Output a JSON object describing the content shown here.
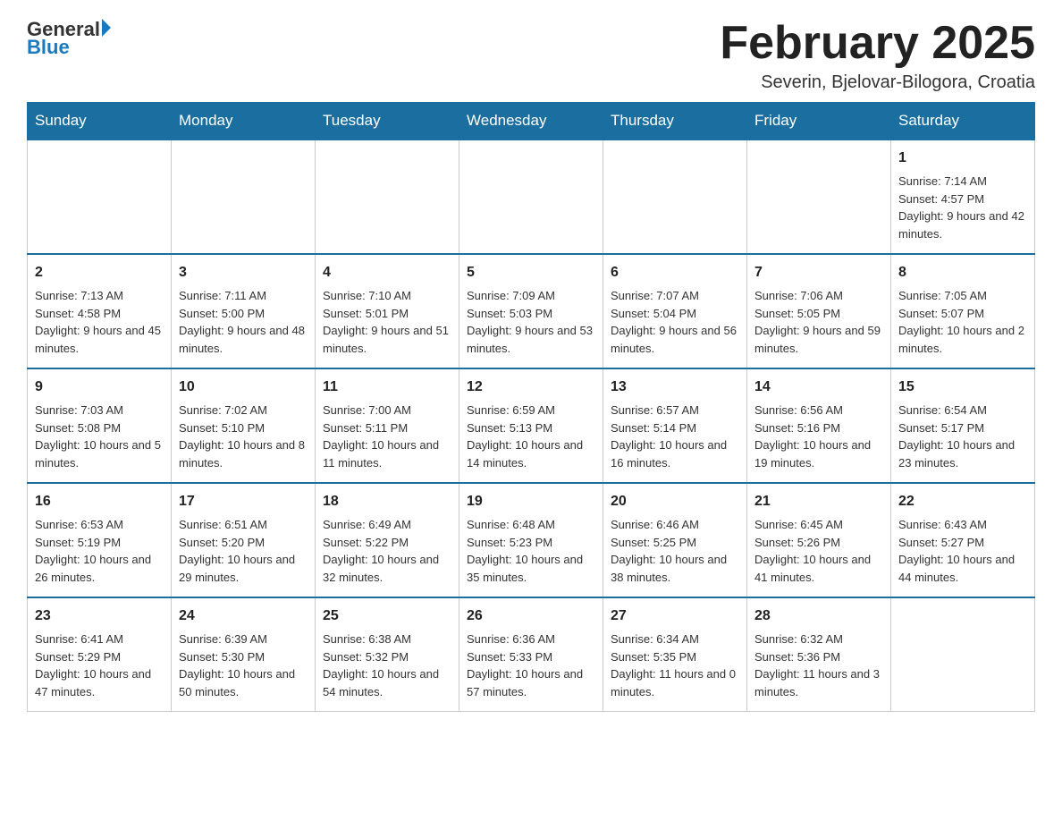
{
  "header": {
    "logo": {
      "general": "General",
      "arrow": "▶",
      "blue": "Blue"
    },
    "title": "February 2025",
    "location": "Severin, Bjelovar-Bilogora, Croatia"
  },
  "calendar": {
    "weekdays": [
      "Sunday",
      "Monday",
      "Tuesday",
      "Wednesday",
      "Thursday",
      "Friday",
      "Saturday"
    ],
    "weeks": [
      [
        {
          "day": "",
          "info": ""
        },
        {
          "day": "",
          "info": ""
        },
        {
          "day": "",
          "info": ""
        },
        {
          "day": "",
          "info": ""
        },
        {
          "day": "",
          "info": ""
        },
        {
          "day": "",
          "info": ""
        },
        {
          "day": "1",
          "info": "Sunrise: 7:14 AM\nSunset: 4:57 PM\nDaylight: 9 hours and 42 minutes."
        }
      ],
      [
        {
          "day": "2",
          "info": "Sunrise: 7:13 AM\nSunset: 4:58 PM\nDaylight: 9 hours and 45 minutes."
        },
        {
          "day": "3",
          "info": "Sunrise: 7:11 AM\nSunset: 5:00 PM\nDaylight: 9 hours and 48 minutes."
        },
        {
          "day": "4",
          "info": "Sunrise: 7:10 AM\nSunset: 5:01 PM\nDaylight: 9 hours and 51 minutes."
        },
        {
          "day": "5",
          "info": "Sunrise: 7:09 AM\nSunset: 5:03 PM\nDaylight: 9 hours and 53 minutes."
        },
        {
          "day": "6",
          "info": "Sunrise: 7:07 AM\nSunset: 5:04 PM\nDaylight: 9 hours and 56 minutes."
        },
        {
          "day": "7",
          "info": "Sunrise: 7:06 AM\nSunset: 5:05 PM\nDaylight: 9 hours and 59 minutes."
        },
        {
          "day": "8",
          "info": "Sunrise: 7:05 AM\nSunset: 5:07 PM\nDaylight: 10 hours and 2 minutes."
        }
      ],
      [
        {
          "day": "9",
          "info": "Sunrise: 7:03 AM\nSunset: 5:08 PM\nDaylight: 10 hours and 5 minutes."
        },
        {
          "day": "10",
          "info": "Sunrise: 7:02 AM\nSunset: 5:10 PM\nDaylight: 10 hours and 8 minutes."
        },
        {
          "day": "11",
          "info": "Sunrise: 7:00 AM\nSunset: 5:11 PM\nDaylight: 10 hours and 11 minutes."
        },
        {
          "day": "12",
          "info": "Sunrise: 6:59 AM\nSunset: 5:13 PM\nDaylight: 10 hours and 14 minutes."
        },
        {
          "day": "13",
          "info": "Sunrise: 6:57 AM\nSunset: 5:14 PM\nDaylight: 10 hours and 16 minutes."
        },
        {
          "day": "14",
          "info": "Sunrise: 6:56 AM\nSunset: 5:16 PM\nDaylight: 10 hours and 19 minutes."
        },
        {
          "day": "15",
          "info": "Sunrise: 6:54 AM\nSunset: 5:17 PM\nDaylight: 10 hours and 23 minutes."
        }
      ],
      [
        {
          "day": "16",
          "info": "Sunrise: 6:53 AM\nSunset: 5:19 PM\nDaylight: 10 hours and 26 minutes."
        },
        {
          "day": "17",
          "info": "Sunrise: 6:51 AM\nSunset: 5:20 PM\nDaylight: 10 hours and 29 minutes."
        },
        {
          "day": "18",
          "info": "Sunrise: 6:49 AM\nSunset: 5:22 PM\nDaylight: 10 hours and 32 minutes."
        },
        {
          "day": "19",
          "info": "Sunrise: 6:48 AM\nSunset: 5:23 PM\nDaylight: 10 hours and 35 minutes."
        },
        {
          "day": "20",
          "info": "Sunrise: 6:46 AM\nSunset: 5:25 PM\nDaylight: 10 hours and 38 minutes."
        },
        {
          "day": "21",
          "info": "Sunrise: 6:45 AM\nSunset: 5:26 PM\nDaylight: 10 hours and 41 minutes."
        },
        {
          "day": "22",
          "info": "Sunrise: 6:43 AM\nSunset: 5:27 PM\nDaylight: 10 hours and 44 minutes."
        }
      ],
      [
        {
          "day": "23",
          "info": "Sunrise: 6:41 AM\nSunset: 5:29 PM\nDaylight: 10 hours and 47 minutes."
        },
        {
          "day": "24",
          "info": "Sunrise: 6:39 AM\nSunset: 5:30 PM\nDaylight: 10 hours and 50 minutes."
        },
        {
          "day": "25",
          "info": "Sunrise: 6:38 AM\nSunset: 5:32 PM\nDaylight: 10 hours and 54 minutes."
        },
        {
          "day": "26",
          "info": "Sunrise: 6:36 AM\nSunset: 5:33 PM\nDaylight: 10 hours and 57 minutes."
        },
        {
          "day": "27",
          "info": "Sunrise: 6:34 AM\nSunset: 5:35 PM\nDaylight: 11 hours and 0 minutes."
        },
        {
          "day": "28",
          "info": "Sunrise: 6:32 AM\nSunset: 5:36 PM\nDaylight: 11 hours and 3 minutes."
        },
        {
          "day": "",
          "info": ""
        }
      ]
    ]
  }
}
